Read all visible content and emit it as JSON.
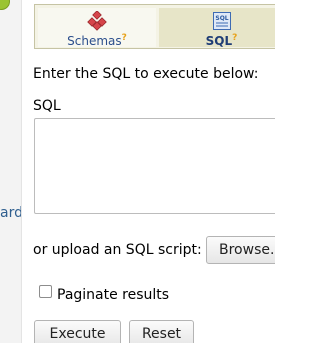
{
  "left_panel": {
    "clipped_text": "ard"
  },
  "tabs": [
    {
      "label": "Schemas",
      "help": "?",
      "icon": "schemas-icon",
      "active": false
    },
    {
      "label": "SQL",
      "help": "?",
      "icon": "sql-icon",
      "active": true
    }
  ],
  "sql_panel": {
    "instruction": "Enter the SQL to execute below:",
    "sql_label": "SQL",
    "sql_value": "",
    "upload_label": "or upload an SQL script:",
    "browse_label": "Browse...",
    "paginate_label": "Paginate results",
    "paginate_checked": false,
    "execute_label": "Execute",
    "reset_label": "Reset"
  },
  "colors": {
    "tab_background": "#f4f3e5",
    "active_tab": "#e7e5c8",
    "link_text": "#2b4e8c",
    "help_mark": "#e7a21b"
  }
}
